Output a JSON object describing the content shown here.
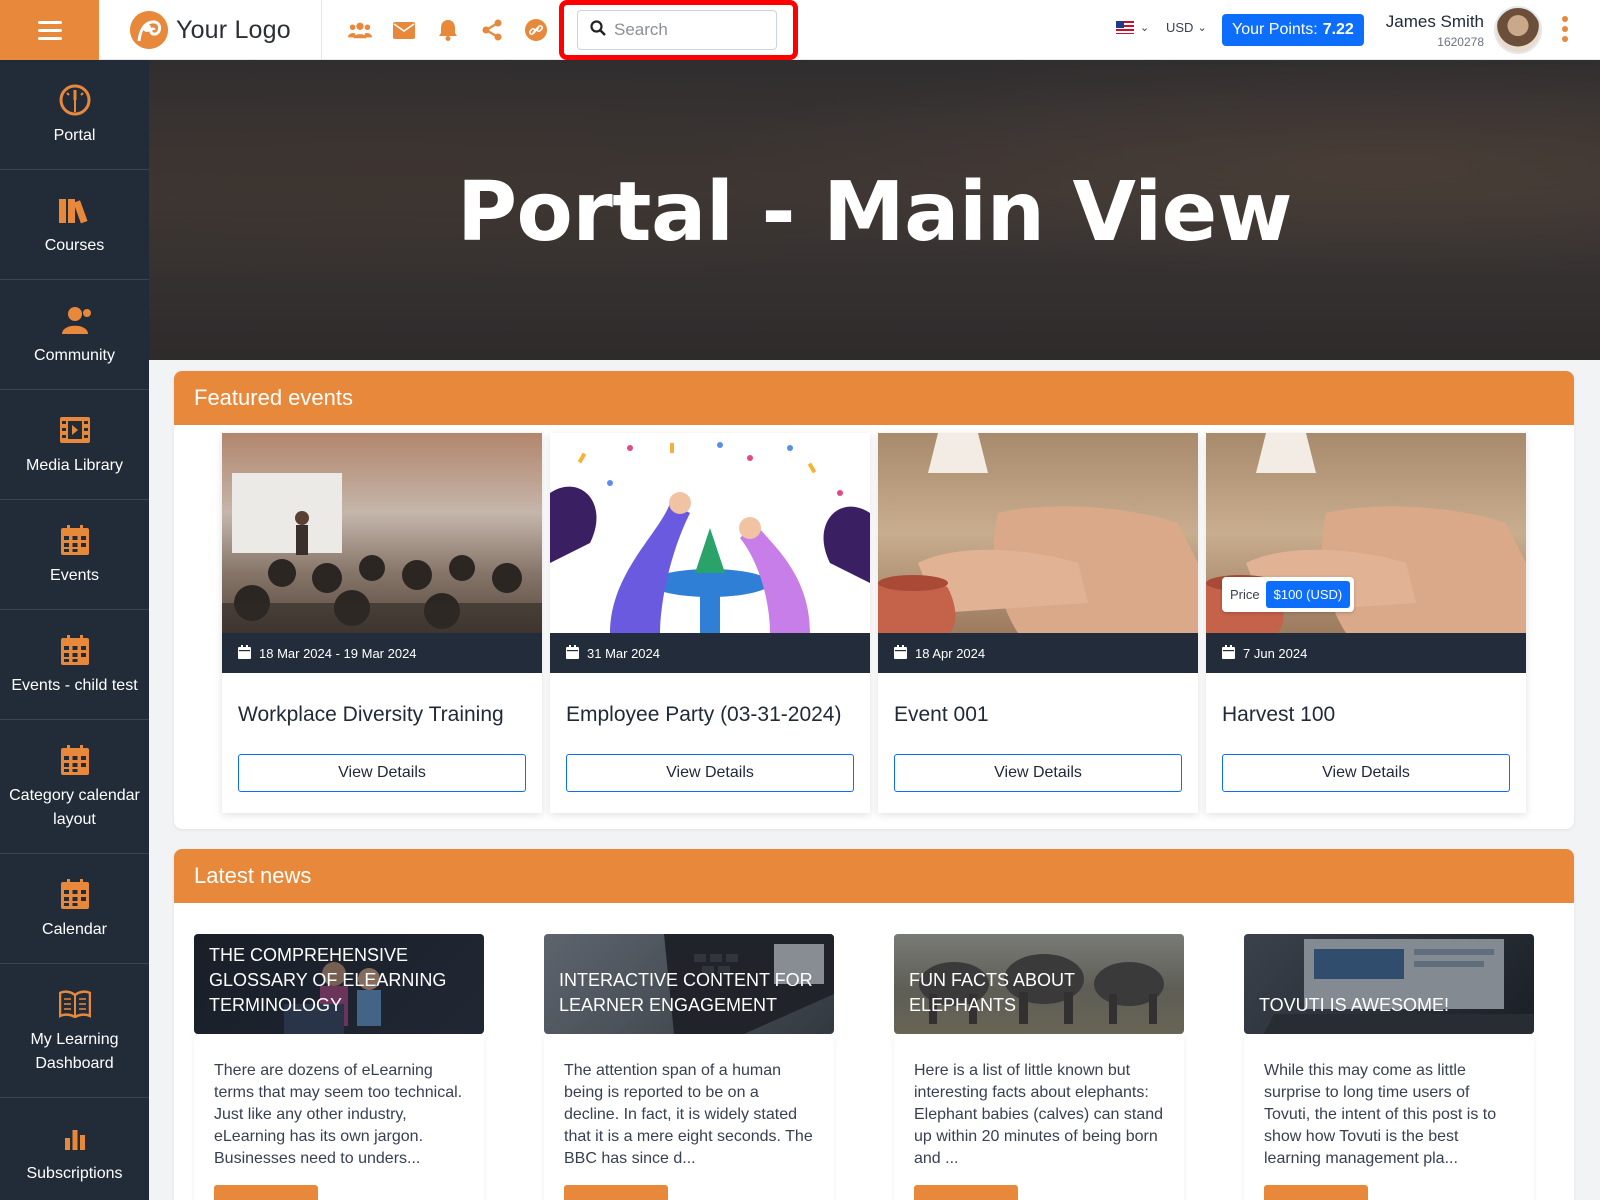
{
  "header": {
    "logo_text": "Your Logo",
    "search_placeholder": "Search",
    "currency": "USD",
    "points_label": "Your Points:",
    "points_value": "7.22",
    "user_name": "James Smith",
    "user_id": "1620278"
  },
  "sidebar": {
    "items": [
      {
        "label": "Portal",
        "icon": "dashboard-gauge-icon"
      },
      {
        "label": "Courses",
        "icon": "books-icon"
      },
      {
        "label": "Community",
        "icon": "user-group-icon"
      },
      {
        "label": "Media Library",
        "icon": "film-icon"
      },
      {
        "label": "Events",
        "icon": "calendar-icon"
      },
      {
        "label": "Events - child test",
        "icon": "calendar-icon"
      },
      {
        "label": "Category calendar layout",
        "icon": "calendar-icon"
      },
      {
        "label": "Calendar",
        "icon": "calendar-icon"
      },
      {
        "label": "My Learning Dashboard",
        "icon": "open-book-icon"
      },
      {
        "label": "Subscriptions",
        "icon": "bar-chart-icon"
      }
    ]
  },
  "hero": {
    "title": "Portal - Main View"
  },
  "featured_events": {
    "heading": "Featured events",
    "button_label": "View Details",
    "items": [
      {
        "date": "18 Mar 2024 - 19 Mar 2024",
        "title": "Workplace Diversity Training"
      },
      {
        "date": "31 Mar 2024",
        "title": "Employee Party (03-31-2024)"
      },
      {
        "date": "18 Apr 2024",
        "title": "Event 001"
      },
      {
        "date": "7 Jun 2024",
        "title": "Harvest 100",
        "price_label": "Price",
        "price_value": "$100 (USD)"
      }
    ]
  },
  "latest_news": {
    "heading": "Latest news",
    "items": [
      {
        "title": "THE COMPREHENSIVE GLOSSARY OF ELEARNING TERMINOLOGY",
        "excerpt": "There are dozens of eLearning terms that may seem too technical. Just like any other industry, eLearning has its own jargon. Businesses need to unders..."
      },
      {
        "title": "INTERACTIVE CONTENT FOR LEARNER ENGAGEMENT",
        "excerpt": "The attention span of a human being is reported to be on a decline. In fact, it is widely stated that it is a mere eight seconds. The BBC has since d..."
      },
      {
        "title": "FUN FACTS ABOUT ELEPHANTS",
        "excerpt": "Here is a list of little known but interesting facts about elephants:  Elephant babies (calves) can stand up within 20 minutes of being born and ..."
      },
      {
        "title": "TOVUTI IS AWESOME!",
        "excerpt": "While this may come as little surprise to long time users of Tovuti, the intent of this post is to show how Tovuti is the best learning management pla..."
      }
    ]
  },
  "colors": {
    "accent": "#e8883a",
    "sidebar_bg": "#222b38",
    "primary": "#0d6efd",
    "highlight": "#ff0000"
  }
}
